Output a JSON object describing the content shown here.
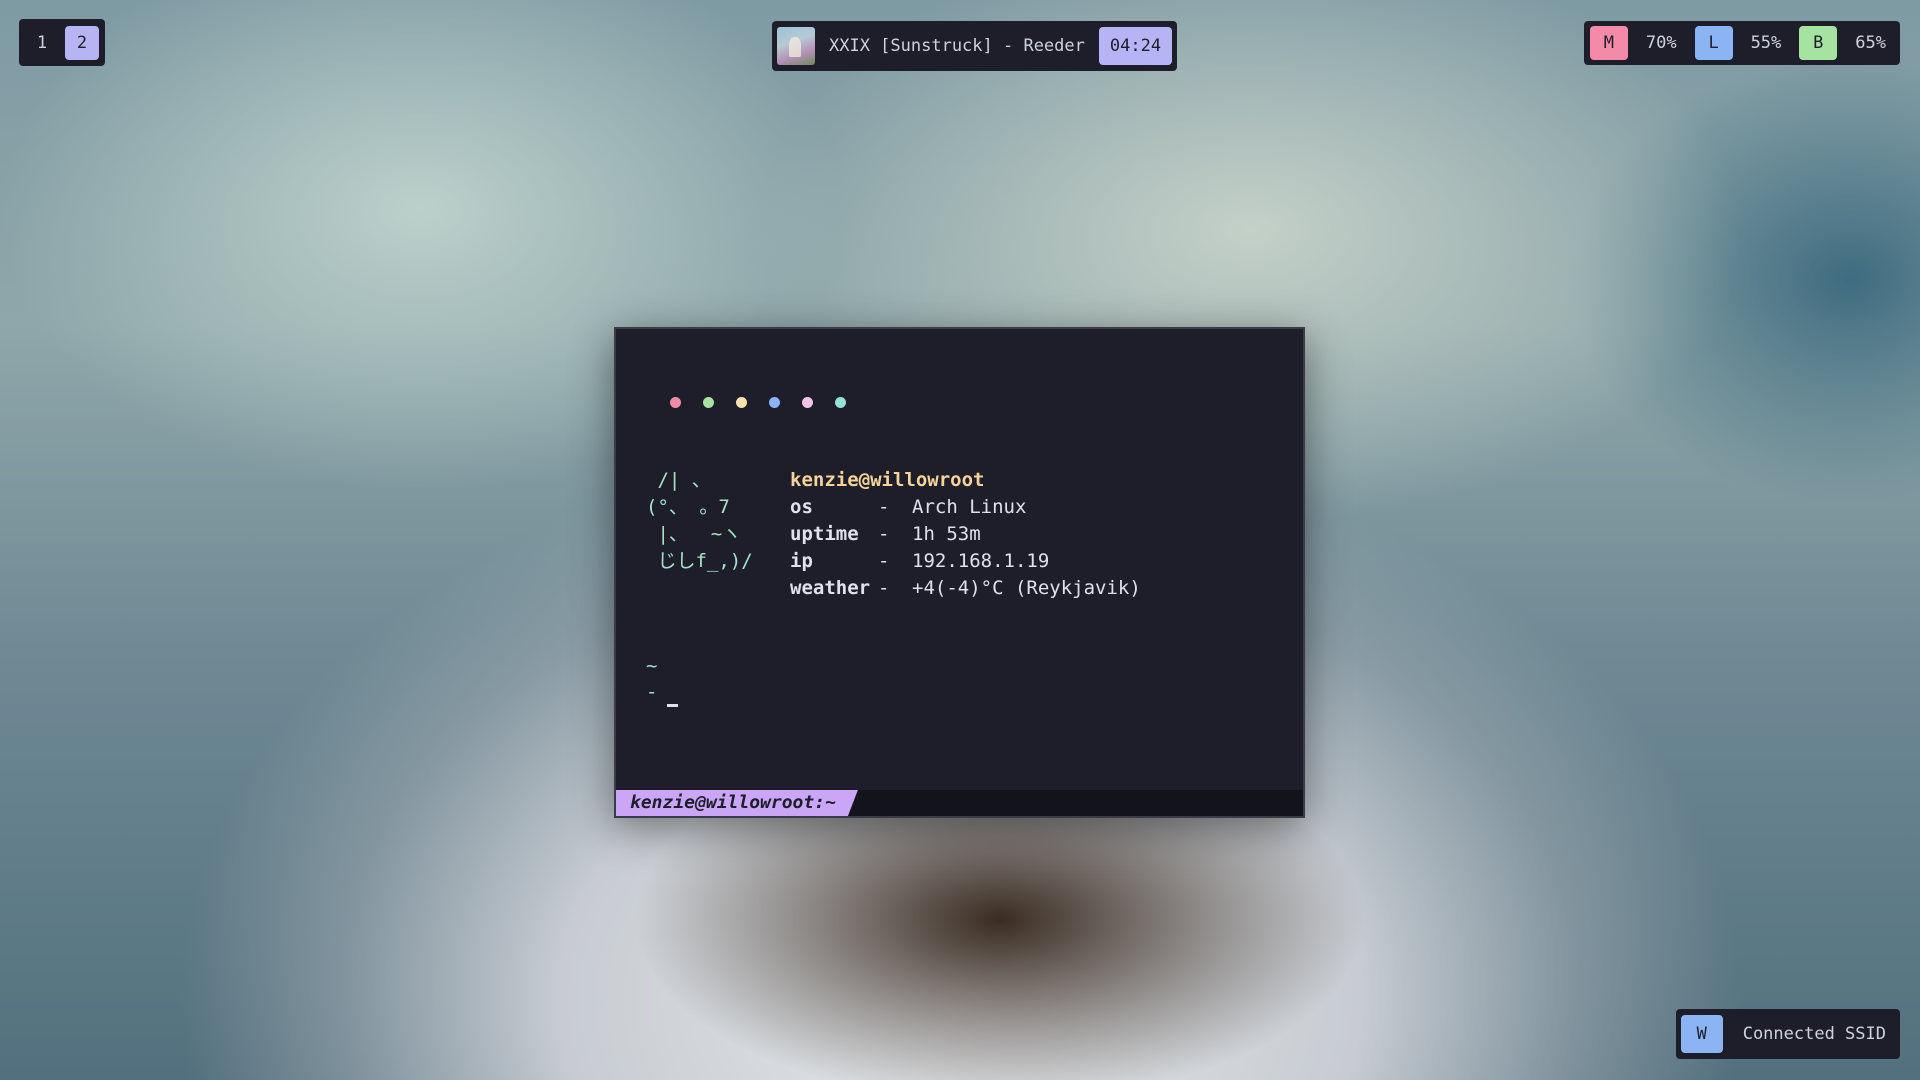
{
  "workspaces": [
    {
      "label": "1",
      "active": false
    },
    {
      "label": "2",
      "active": true
    }
  ],
  "now_playing": {
    "title": "XXIX [Sunstruck] - Reeder",
    "time": "04:24"
  },
  "status": {
    "items": [
      {
        "badge": "M",
        "value": "70%",
        "color": "#f38ba8"
      },
      {
        "badge": "L",
        "value": "55%",
        "color": "#8ab4f3"
      },
      {
        "badge": "B",
        "value": "65%",
        "color": "#a6e3a1"
      }
    ]
  },
  "wifi": {
    "badge": "W",
    "label": "Connected SSID"
  },
  "terminal": {
    "dot_colors": [
      "#f38ba8",
      "#a6e3a1",
      "#f9e2af",
      "#89b4fa",
      "#f5c2e7",
      "#94e2d5"
    ],
    "ascii_art": " /| 、\n(°、 。7\n |、  ~ヽ\n じしf_,)/",
    "user": "kenzie@willowroot",
    "info": [
      {
        "key": "os",
        "sep": "-",
        "value": "Arch Linux"
      },
      {
        "key": "uptime",
        "sep": "-",
        "value": "1h 53m"
      },
      {
        "key": "ip",
        "sep": "-",
        "value": "192.168.1.19"
      },
      {
        "key": "weather",
        "sep": "-",
        "value": "+4(-4)°C (Reykjavik)"
      }
    ],
    "prompt_dir": "~",
    "prompt_symbol": "-",
    "statusline": "kenzie@willowroot:~"
  }
}
